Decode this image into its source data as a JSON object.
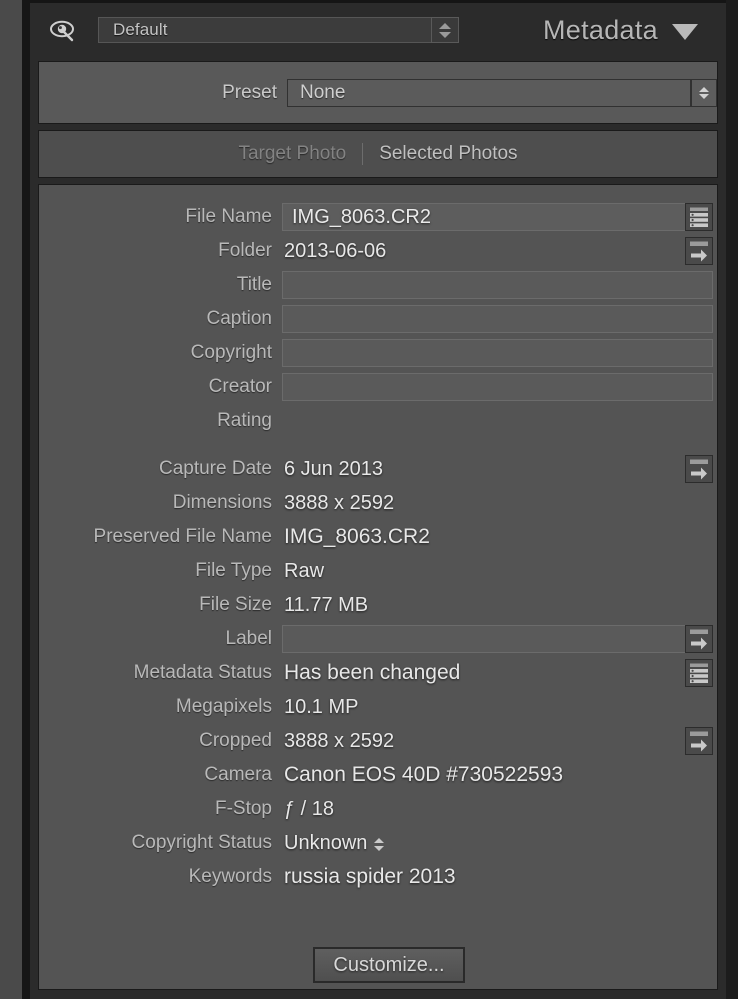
{
  "header": {
    "eye_icon": "eye-icon",
    "default_preset_value": "Default",
    "panel_title": "Metadata",
    "collapse_icon": "triangle-down-icon"
  },
  "preset": {
    "label": "Preset",
    "value": "None"
  },
  "tabs": {
    "target_photo": "Target Photo",
    "selected_photos": "Selected Photos"
  },
  "fields": [
    {
      "label": "File Name",
      "value": "IMG_8063.CR2",
      "type": "box-filled",
      "icon": "list-icon"
    },
    {
      "label": "Folder",
      "value": "2013-06-06",
      "type": "text",
      "icon": "arrow-right-icon"
    },
    {
      "label": "Title",
      "value": "",
      "type": "box",
      "icon": ""
    },
    {
      "label": "Caption",
      "value": "",
      "type": "box",
      "icon": ""
    },
    {
      "label": "Copyright",
      "value": "",
      "type": "box",
      "icon": ""
    },
    {
      "label": "Creator",
      "value": "",
      "type": "box",
      "icon": ""
    },
    {
      "label": "Rating",
      "value": "",
      "type": "blank",
      "icon": ""
    },
    {
      "label": "Capture Date",
      "value": "6 Jun 2013",
      "type": "text",
      "icon": "arrow-right-icon"
    },
    {
      "label": "Dimensions",
      "value": "3888 x 2592",
      "type": "text",
      "icon": ""
    },
    {
      "label": "Preserved File Name",
      "value": "IMG_8063.CR2",
      "type": "text-big",
      "icon": ""
    },
    {
      "label": "File Type",
      "value": "Raw",
      "type": "text",
      "icon": ""
    },
    {
      "label": "File Size",
      "value": "11.77 MB",
      "type": "text",
      "icon": ""
    },
    {
      "label": "Label",
      "value": "",
      "type": "box",
      "icon": "arrow-right-icon"
    },
    {
      "label": "Metadata Status",
      "value": "Has been changed",
      "type": "text-big",
      "icon": "list-icon"
    },
    {
      "label": "Megapixels",
      "value": "10.1 MP",
      "type": "text",
      "icon": ""
    },
    {
      "label": "Cropped",
      "value": "3888 x 2592",
      "type": "text",
      "icon": "arrow-right-icon"
    },
    {
      "label": "Camera",
      "value": "Canon EOS 40D #730522593",
      "type": "text-big",
      "icon": ""
    },
    {
      "label": "F-Stop",
      "value": "ƒ / 18",
      "type": "text",
      "icon": ""
    },
    {
      "label": "Copyright Status",
      "value": "Unknown",
      "type": "text",
      "icon": "mini-stepper"
    },
    {
      "label": "Keywords",
      "value": "russia spider 2013",
      "type": "text-big",
      "icon": ""
    }
  ],
  "customize": {
    "label": "Customize..."
  },
  "colors": {
    "panel_bg": "#2b2b2b",
    "fields_bg": "#545454",
    "preset_row_bg": "#595959",
    "tab_row_bg": "#4e4e4e",
    "label_text": "#b9b9b9",
    "value_text": "#e8e8e8",
    "inactive_tab": "#838383"
  }
}
